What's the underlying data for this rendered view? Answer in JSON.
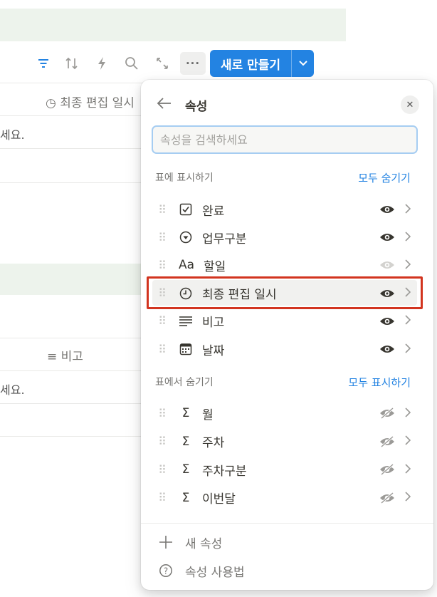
{
  "toolbar": {
    "icons": [
      "filter-icon",
      "sort-icon",
      "automation-icon",
      "search-icon",
      "expand-icon",
      "more-icon"
    ],
    "more_label": "···",
    "new_button_label": "새로 만들기",
    "accent": "#2383e2"
  },
  "background": {
    "col_last_edited": "최종 편집 일시",
    "cell_text_1": "세요.",
    "col_note": "비고",
    "cell_text_2": "세요."
  },
  "panel": {
    "title": "속성",
    "search_placeholder": "속성을 검색하세요",
    "shown_section": {
      "title": "표에 표시하기",
      "action": "모두 숨기기",
      "items": [
        {
          "icon": "checkbox-icon",
          "glyph": "☑",
          "label": "완료",
          "visible": true
        },
        {
          "icon": "select-icon",
          "glyph": "▼",
          "label": "업무구분",
          "visible": true
        },
        {
          "icon": "text-type-icon",
          "glyph": "Aa",
          "label": "할일",
          "visible": true
        },
        {
          "icon": "clock-icon",
          "glyph": "◷",
          "label": "최종 편집 일시",
          "visible": true
        },
        {
          "icon": "lines-icon",
          "glyph": "≡",
          "label": "비고",
          "visible": true
        },
        {
          "icon": "calendar-icon",
          "glyph": "▦",
          "label": "날짜",
          "visible": true
        }
      ]
    },
    "hidden_section": {
      "title": "표에서 숨기기",
      "action": "모두 표시하기",
      "items": [
        {
          "icon": "formula-icon",
          "glyph": "Σ",
          "label": "월",
          "visible": false
        },
        {
          "icon": "formula-icon",
          "glyph": "Σ",
          "label": "주차",
          "visible": false
        },
        {
          "icon": "formula-icon",
          "glyph": "Σ",
          "label": "주차구분",
          "visible": false
        },
        {
          "icon": "formula-icon",
          "glyph": "Σ",
          "label": "이번달",
          "visible": false
        }
      ]
    },
    "footer": {
      "new_property": "새 속성",
      "help": "속성 사용법"
    },
    "highlight_color": "#d2341f"
  }
}
